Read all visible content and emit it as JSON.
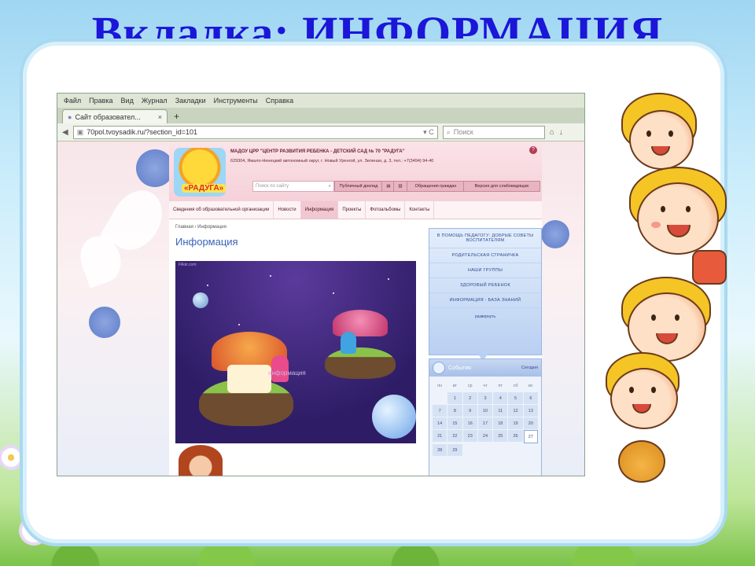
{
  "slide": {
    "title": "Вкладка: ИНФОРМАЦИЯ"
  },
  "browser": {
    "menu": [
      "Файл",
      "Правка",
      "Вид",
      "Журнал",
      "Закладки",
      "Инструменты",
      "Справка"
    ],
    "tab_title": "Сайт образовател...",
    "tab_close": "×",
    "new_tab": "+",
    "url": "70pol.tvoysadik.ru/?section_id=101",
    "search_placeholder": "Поиск"
  },
  "site": {
    "logo_text": "«РАДУГА»",
    "org_name": "МАДОУ ЦРР \"ЦЕНТР РАЗВИТИЯ РЕБЕНКА - ДЕТСКИЙ САД № 70 \"РАДУГА\"",
    "org_address": "629304, Ямало-Ненецкий автономный округ, г. Новый Уренгой, ул. Зеленая, д. 3, тел.: +7(3494) 94-40",
    "help": "?",
    "search_placeholder": "Поиск по сайту",
    "header_buttons": [
      "Публичный доклад",
      "Обращения граждан",
      "Версия для слабовидящих"
    ],
    "nav": [
      "Сведения об образовательной организации",
      "Новости",
      "Информация",
      "Проекты",
      "Фотоальбомы",
      "Контакты"
    ],
    "active_nav_index": 2,
    "breadcrumb": "Главная › Информация",
    "page_heading": "Информация",
    "hero_watermark": "Flikkr.com",
    "hero_label": "информация",
    "sidebar_items": [
      "В ПОМОЩЬ ПЕДАГОГУ: ДОБРЫЕ СОВЕТЫ ВОСПИТАТЕЛЯМ",
      "РОДИТЕЛЬСКАЯ СТРАНИЧКА",
      "НАШИ ГРУППЫ",
      "ЗДОРОВЫЙ РЕБЕНОК",
      "ИНФОРМАЦИЯ - БАЗА ЗНАНИЙ"
    ],
    "sidebar_more": "развернуть",
    "events_title": "События",
    "events_today": "Сегодня",
    "weekdays": [
      "пн",
      "вт",
      "ср",
      "чт",
      "пт",
      "сб",
      "вс"
    ],
    "days": [
      "",
      "1",
      "2",
      "3",
      "4",
      "5",
      "6",
      "7",
      "8",
      "9",
      "10",
      "11",
      "12",
      "13",
      "14",
      "15",
      "16",
      "17",
      "18",
      "19",
      "20",
      "21",
      "22",
      "23",
      "24",
      "25",
      "26",
      "27",
      "28",
      "29",
      "",
      "",
      "",
      "",
      ""
    ],
    "today": "27"
  },
  "colors": {
    "title": "#1b16d8",
    "heading": "#3a62b8",
    "nav_active": "#f1c7d1"
  }
}
